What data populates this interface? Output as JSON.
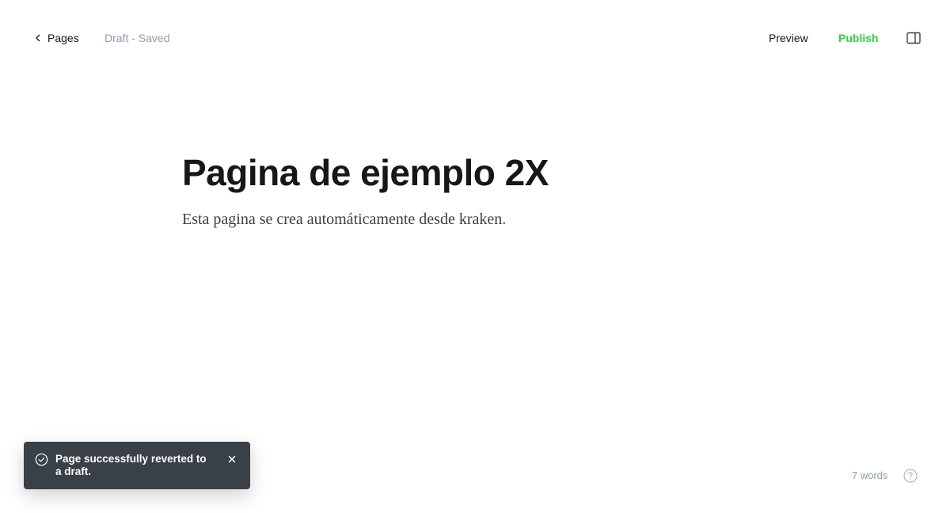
{
  "header": {
    "back_label": "Pages",
    "status_text": "Draft - Saved",
    "preview_label": "Preview",
    "publish_label": "Publish"
  },
  "editor": {
    "title": "Pagina de ejemplo 2X",
    "body": "Esta pagina se crea automáticamente desde kraken."
  },
  "toast": {
    "message": "Page successfully reverted to a draft."
  },
  "footer": {
    "word_count": "7 words"
  },
  "colors": {
    "accent_publish": "#30cf43",
    "toast_bg": "#394047",
    "muted_text": "#8e9cac"
  },
  "icons": {
    "back": "chevron-left-icon",
    "sidebar": "sidebar-panel-icon",
    "toast_status": "check-circle-icon",
    "toast_close": "close-icon",
    "help": "help-circle-icon"
  }
}
